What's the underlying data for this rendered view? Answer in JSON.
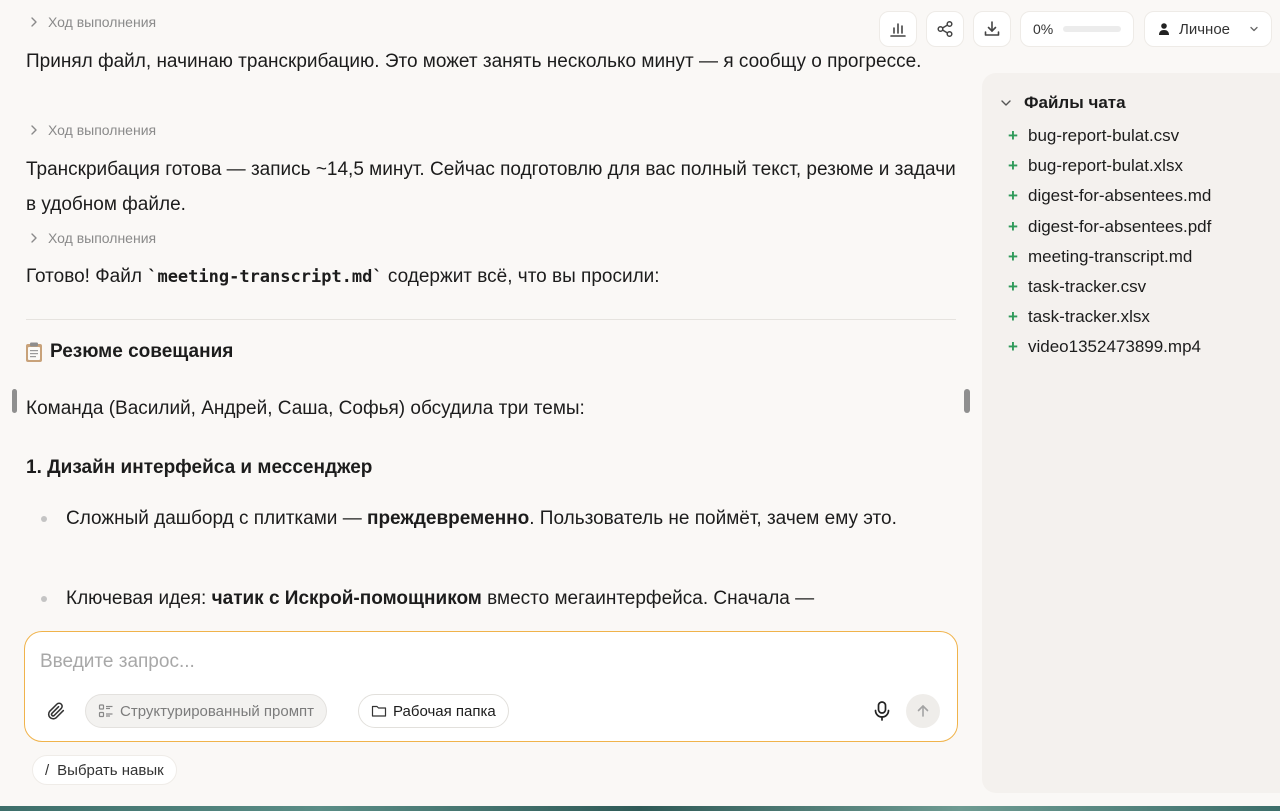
{
  "chat": {
    "progress_label": "Ход выполнения",
    "messages": [
      "Принял файл, начинаю транскрибацию. Это может занять несколько минут — я сообщу о прогрессе.",
      "Транскрибация готова — запись ~14,5 минут. Сейчас подготовлю для вас полный текст, резюме и задачи в удобном файле."
    ],
    "ready_prefix": "Готово! Файл ",
    "ready_code": "`meeting-transcript.md`",
    "ready_suffix": " содержит всё, что вы просили:",
    "summary_title": "Резюме совещания",
    "team_line": "Команда (Василий, Андрей, Саша, Софья) обсудила три темы:",
    "topic_1": "1. Дизайн интерфейса и мессенджер",
    "bullets": [
      {
        "pre": "Сложный дашборд с плитками — ",
        "bold": "преждевременно",
        "post": ". Пользователь не поймёт, зачем ему это."
      },
      {
        "pre": "Ключевая идея: ",
        "bold": "чатик с Искрой-помощником",
        "post": " вместо мегаинтерфейса. Сначала —"
      }
    ]
  },
  "toolbar": {
    "stats_icon": "bar-chart-icon",
    "share_icon": "share-icon",
    "download_icon": "download-icon",
    "progress_text": "0%",
    "progress_value": 0,
    "workspace_label": "Личное"
  },
  "files": {
    "header": "Файлы чата",
    "items": [
      "bug-report-bulat.csv",
      "bug-report-bulat.xlsx",
      "digest-for-absentees.md",
      "digest-for-absentees.pdf",
      "meeting-transcript.md",
      "task-tracker.csv",
      "task-tracker.xlsx",
      "video1352473899.mp4"
    ]
  },
  "composer": {
    "placeholder": "Введите запрос...",
    "structured_prompt_label": "Структурированный промпт",
    "work_folder_label": "Рабочая папка"
  },
  "skill": {
    "slash": "/",
    "label": "Выбрать навык"
  },
  "colors": {
    "accent": "#f0b34b",
    "file_plus": "#2f9a5a",
    "background": "#faf8f6",
    "panel": "#f4f1ee"
  }
}
